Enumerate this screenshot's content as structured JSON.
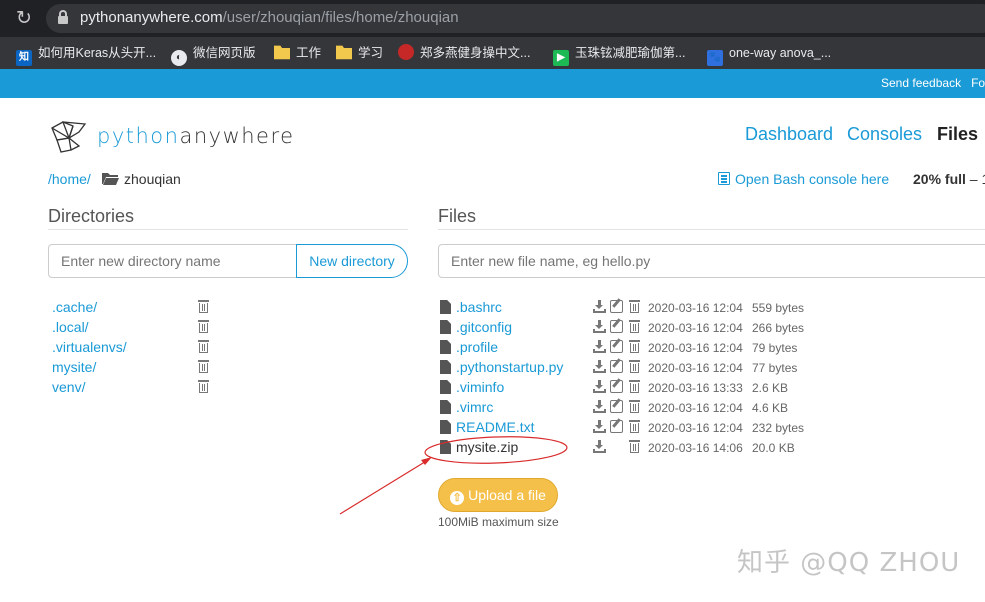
{
  "browser": {
    "url_host": "pythonanywhere.com",
    "url_path": "/user/zhouqian/files/home/zhouqian",
    "bookmarks": [
      {
        "icon": "zhihu-icon",
        "label": "如何用Keras从头开...",
        "color": "#0a66c2",
        "glyph": "知"
      },
      {
        "icon": "globe-icon",
        "label": "微信网页版",
        "color": "#e8eaed",
        "glyph": ""
      },
      {
        "icon": "folder-icon",
        "label": "工作",
        "color": "#f2c94c",
        "glyph": ""
      },
      {
        "icon": "folder-icon",
        "label": "学习",
        "color": "#f2c94c",
        "glyph": ""
      },
      {
        "icon": "netease-icon",
        "label": "郑多燕健身操中文...",
        "color": "#c62828",
        "glyph": ""
      },
      {
        "icon": "video-icon",
        "label": "玉珠铉减肥瑜伽第...",
        "color": "#1db954",
        "glyph": "▶"
      },
      {
        "icon": "baidu-icon",
        "label": "one-way anova_...",
        "color": "#2f6fde",
        "glyph": "🐾"
      }
    ]
  },
  "header": {
    "feedback": "Send feedback",
    "feedback_cut": "Fo"
  },
  "logo": {
    "py": "python",
    "rest": "anywhere"
  },
  "nav": [
    "Dashboard",
    "Consoles",
    "Files"
  ],
  "breadcrumb": {
    "root": "/home/",
    "current": "zhouqian"
  },
  "bash_link": "Open Bash console here",
  "usage": {
    "percent": "20% full",
    "rest": " – 1"
  },
  "directories": {
    "title": "Directories",
    "input_placeholder": "Enter new directory name",
    "button": "New directory",
    "items": [
      ".cache/",
      ".local/",
      ".virtualenvs/",
      "mysite/",
      "venv/"
    ]
  },
  "files": {
    "title": "Files",
    "input_placeholder": "Enter new file name, eg hello.py",
    "items": [
      {
        "name": ".bashrc",
        "date": "2020-03-16 12:04",
        "size": "559 bytes",
        "editable": true
      },
      {
        "name": ".gitconfig",
        "date": "2020-03-16 12:04",
        "size": "266 bytes",
        "editable": true
      },
      {
        "name": ".profile",
        "date": "2020-03-16 12:04",
        "size": "79 bytes",
        "editable": true
      },
      {
        "name": ".pythonstartup.py",
        "date": "2020-03-16 12:04",
        "size": "77 bytes",
        "editable": true
      },
      {
        "name": ".viminfo",
        "date": "2020-03-16 13:33",
        "size": "2.6 KB",
        "editable": true
      },
      {
        "name": ".vimrc",
        "date": "2020-03-16 12:04",
        "size": "4.6 KB",
        "editable": true
      },
      {
        "name": "README.txt",
        "date": "2020-03-16 12:04",
        "size": "232 bytes",
        "editable": true
      },
      {
        "name": "mysite.zip",
        "date": "2020-03-16 14:06",
        "size": "20.0 KB",
        "editable": false
      }
    ],
    "upload_button": "Upload a file",
    "max_size": "100MiB maximum size"
  },
  "annotation_color": "#d92b2b",
  "watermark": "知乎 @QQ ZHOU"
}
